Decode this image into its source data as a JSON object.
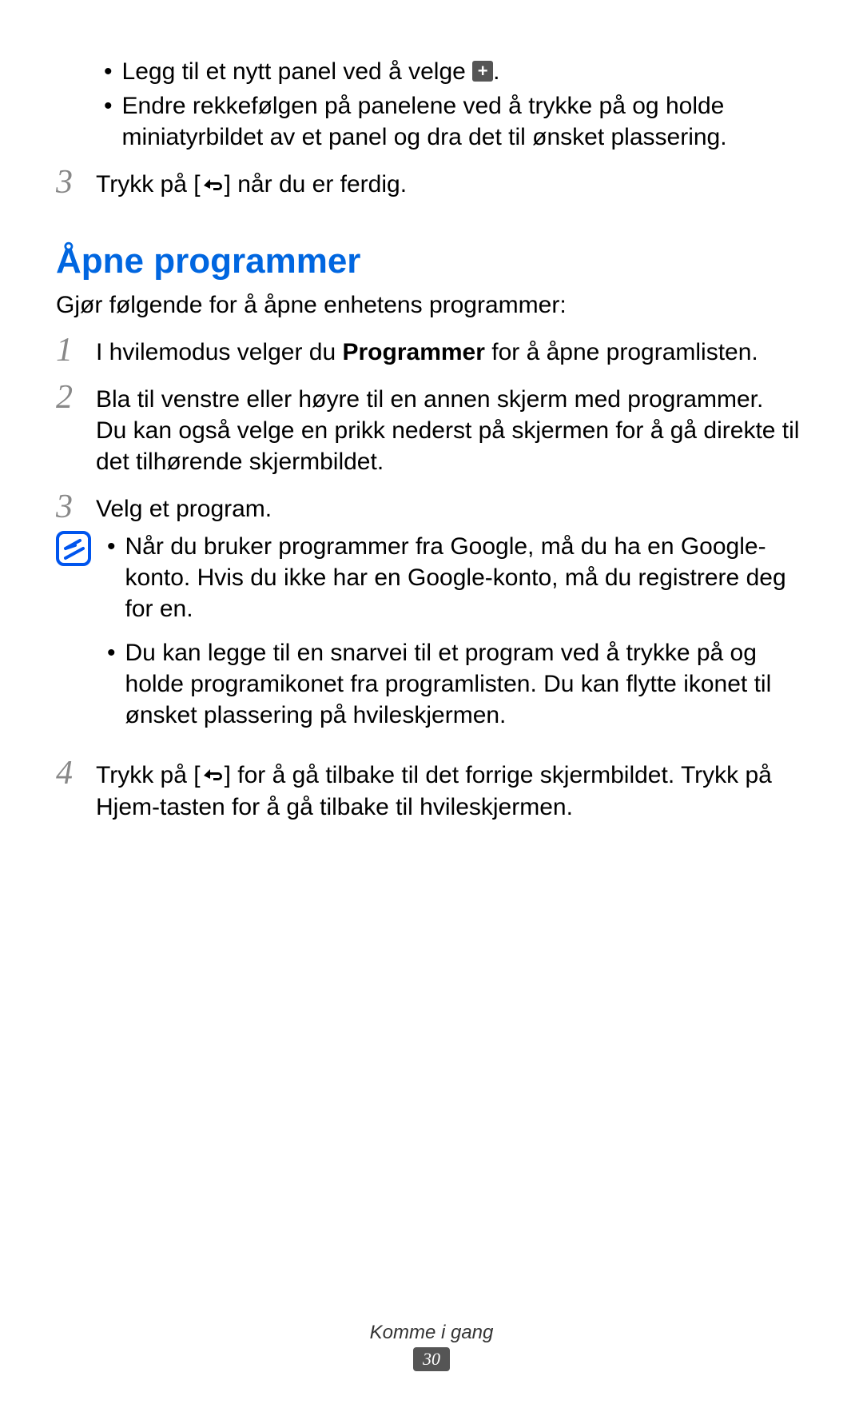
{
  "top_bullets": {
    "b1_pre": "Legg til et nytt panel ved å velge ",
    "b1_post": ".",
    "b2": "Endre rekkefølgen på panelene ved å trykke på og holde miniatyrbildet av et panel og dra det til ønsket plassering."
  },
  "step3_top_pre": "Trykk på [",
  "step3_top_post": "] når du er ferdig.",
  "heading": "Åpne programmer",
  "intro": "Gjør følgende for å åpne enhetens programmer:",
  "step1_pre": "I hvilemodus velger du ",
  "step1_bold": "Programmer",
  "step1_post": " for å åpne programlisten.",
  "step2_line1": "Bla til venstre eller høyre til en annen skjerm med programmer.",
  "step2_line2": "Du kan også velge en prikk nederst på skjermen for å gå direkte til det tilhørende skjermbildet.",
  "step3": "Velg et program.",
  "note_b1": "Når du bruker programmer fra Google, må du ha en Google-konto. Hvis du ikke har en Google-konto, må du registrere deg for en.",
  "note_b2": "Du kan legge til en snarvei til et program ved å trykke på og holde programikonet fra programlisten. Du kan flytte ikonet til ønsket plassering på hvileskjermen.",
  "step4_pre": "Trykk på [",
  "step4_mid": "] for å gå tilbake til det forrige skjermbildet. Trykk på Hjem-tasten for å gå tilbake til hvileskjermen.",
  "footer_label": "Komme i gang",
  "page_number": "30",
  "numbers": {
    "n1": "1",
    "n2": "2",
    "n3": "3",
    "n4": "4"
  }
}
